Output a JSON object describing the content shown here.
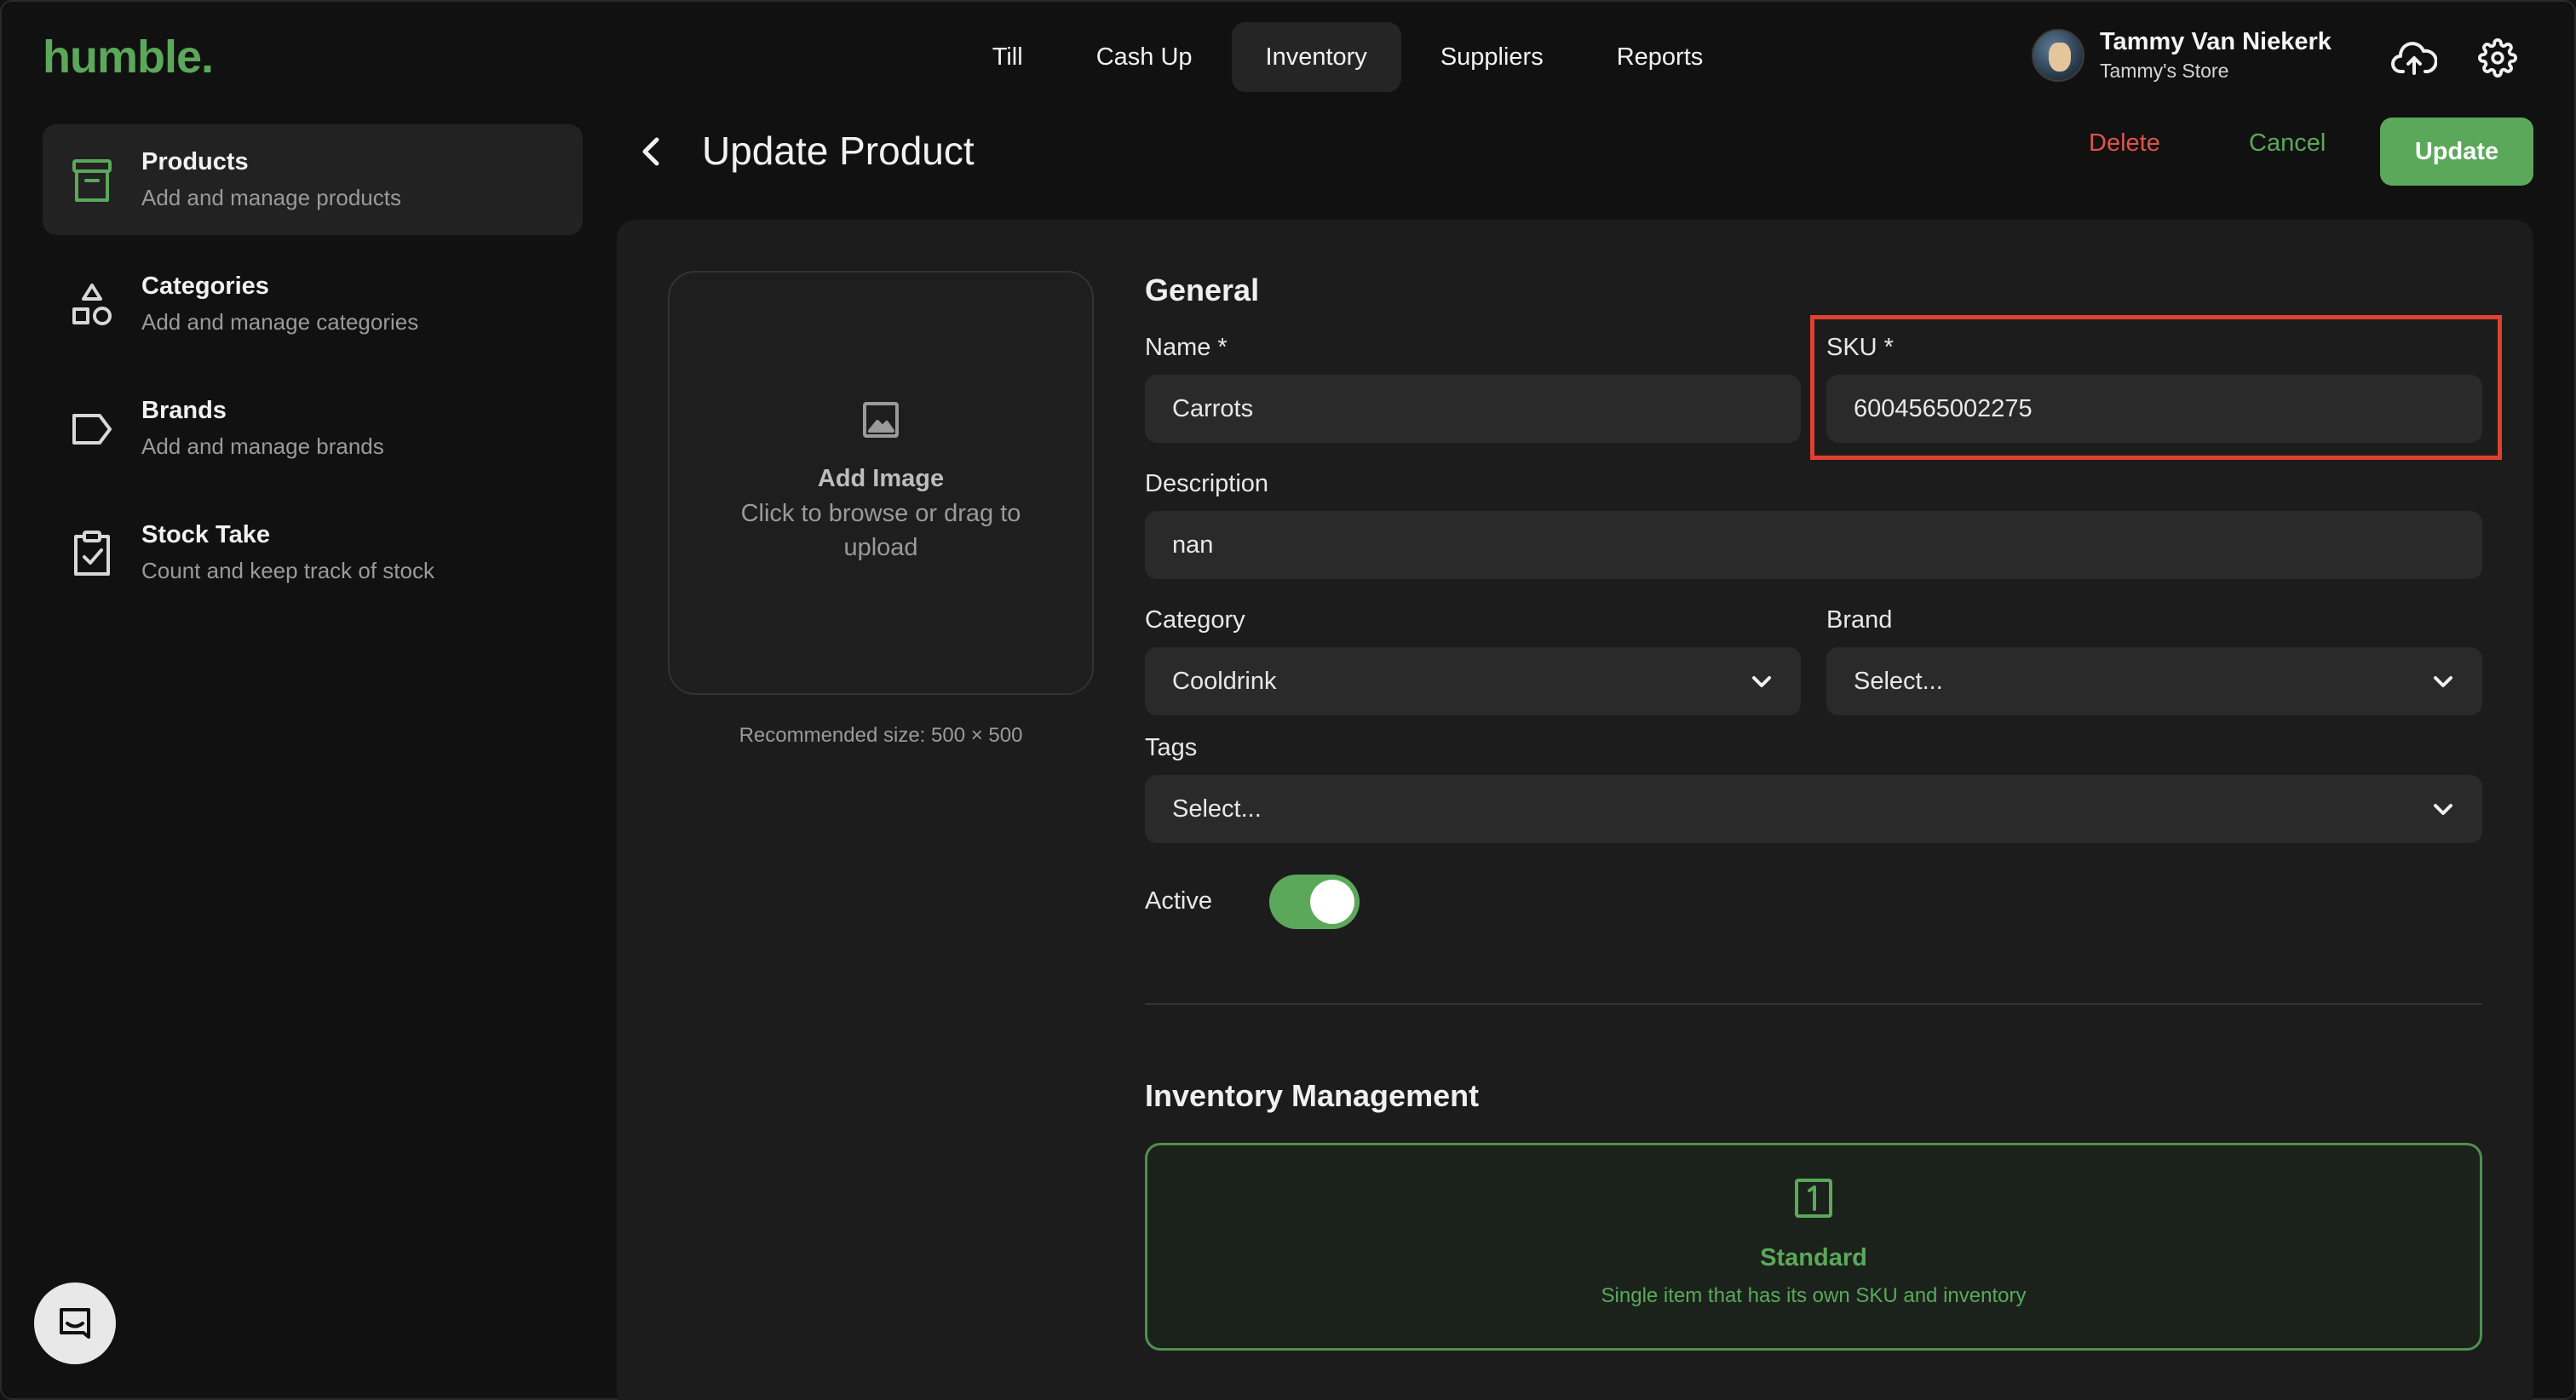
{
  "app": {
    "logo": "humble.",
    "brand_color": "#5ba85b"
  },
  "topnav": {
    "tabs": [
      {
        "label": "Till",
        "active": false
      },
      {
        "label": "Cash Up",
        "active": false
      },
      {
        "label": "Inventory",
        "active": true
      },
      {
        "label": "Suppliers",
        "active": false
      },
      {
        "label": "Reports",
        "active": false
      }
    ]
  },
  "user": {
    "name": "Tammy Van Niekerk",
    "store": "Tammy's Store"
  },
  "icons": {
    "upload": "cloud-upload-icon",
    "settings": "gear-icon"
  },
  "sidebar": {
    "items": [
      {
        "title": "Products",
        "subtitle": "Add and manage products",
        "icon": "archive-box-icon",
        "active": true
      },
      {
        "title": "Categories",
        "subtitle": "Add and manage categories",
        "icon": "shapes-icon",
        "active": false
      },
      {
        "title": "Brands",
        "subtitle": "Add and manage brands",
        "icon": "tag-icon",
        "active": false
      },
      {
        "title": "Stock Take",
        "subtitle": "Count and keep track of stock",
        "icon": "clipboard-check-icon",
        "active": false
      }
    ]
  },
  "header": {
    "title": "Update Product",
    "delete_label": "Delete",
    "cancel_label": "Cancel",
    "update_label": "Update"
  },
  "image": {
    "title": "Add Image",
    "hint": "Click to browse or drag to upload",
    "recommended": "Recommended size: 500 × 500"
  },
  "general": {
    "title": "General",
    "name_label": "Name *",
    "name_value": "Carrots",
    "sku_label": "SKU *",
    "sku_value": "6004565002275",
    "description_label": "Description",
    "description_value": "nan",
    "category_label": "Category",
    "category_value": "Cooldrink",
    "brand_label": "Brand",
    "brand_value": "Select...",
    "tags_label": "Tags",
    "tags_value": "Select...",
    "active_label": "Active",
    "active": true
  },
  "inventory": {
    "title": "Inventory Management",
    "option_title": "Standard",
    "option_desc": "Single item that has its own SKU and inventory"
  }
}
